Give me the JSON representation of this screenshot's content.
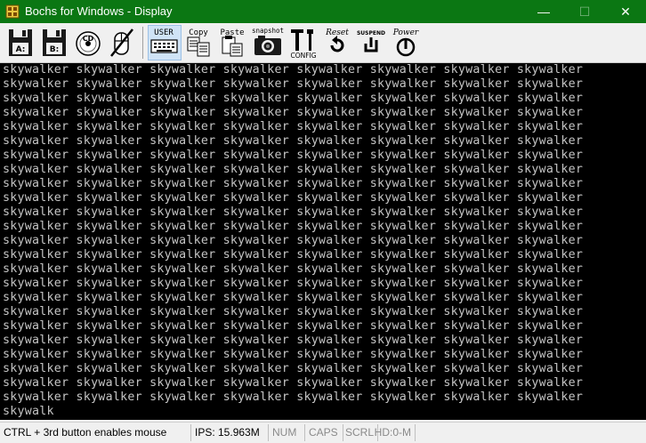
{
  "window": {
    "title": "Bochs for Windows - Display",
    "minimize_glyph": "—",
    "maximize_glyph": "☐",
    "close_glyph": "✕"
  },
  "toolbar": {
    "floppy_a_label": "A:",
    "floppy_b_label": "B:",
    "cdrom_label": "CD",
    "user_label": "USER",
    "copy_label": "Copy",
    "paste_label": "Paste",
    "snapshot_label": "snapshot",
    "config_label": "CONFIG",
    "reset_label": "Reset",
    "suspend_label": "SUSPEND",
    "power_label": "Power"
  },
  "screen": {
    "word": "skywalker",
    "words_per_line": 8,
    "full_lines": 24,
    "last_line": "skywalk",
    "text_color": "#c4c4c4"
  },
  "statusbar": {
    "hint": "CTRL + 3rd button enables mouse",
    "ips": "IPS: 15.963M",
    "num": "NUM",
    "caps": "CAPS",
    "scrl": "SCRL",
    "hd": "HD:0-M"
  },
  "colors": {
    "titlebar": "#0b7713",
    "toolbar": "#f0f0f0",
    "screen_bg": "#000000",
    "user_highlight": "#cfe3f6"
  }
}
